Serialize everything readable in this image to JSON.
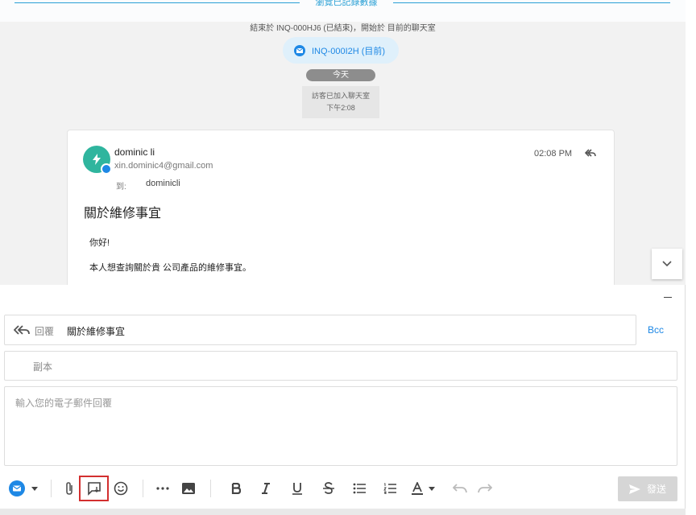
{
  "banner": {
    "link_text": "瀏覽已記錄數據"
  },
  "chat": {
    "ended_note": "結束於 INQ-000HJ6 (已結束)，開始於 目前的聊天室",
    "conversation_chip": "INQ-000I2H (目前)",
    "date_divider": "今天",
    "system_message": {
      "text": "訪客已加入聊天室",
      "time": "下午2:08"
    },
    "message": {
      "sender_name": "dominic li",
      "sender_email": "xin.dominic4@gmail.com",
      "to_label": "到:",
      "to_value": "dominicli",
      "time": "02:08 PM",
      "subject": "關於維修事宜",
      "body_line1": "你好!",
      "body_line2": "本人想查詢關於貴 公司產品的維修事宜。"
    }
  },
  "composer": {
    "reply_label": "回覆",
    "reply_subject": "關於維修事宜",
    "bcc_label": "Bcc",
    "cc_placeholder": "副本",
    "body_placeholder": "輸入您的電子郵件回覆",
    "send_label": "發送"
  },
  "colors": {
    "accent": "#1e88e5",
    "avatar": "#2fb59e",
    "highlight": "#d32f2f",
    "send_disabled": "#d6d6d6"
  },
  "icons": [
    "mail-icon",
    "chevron-down-icon",
    "attachment-icon",
    "canned-response-icon",
    "emoji-icon",
    "more-icon",
    "image-icon",
    "bold-icon",
    "italic-icon",
    "underline-icon",
    "strikethrough-icon",
    "bullet-list-icon",
    "numbered-list-icon",
    "text-color-icon",
    "undo-icon",
    "redo-icon",
    "send-icon",
    "reply-icon"
  ]
}
